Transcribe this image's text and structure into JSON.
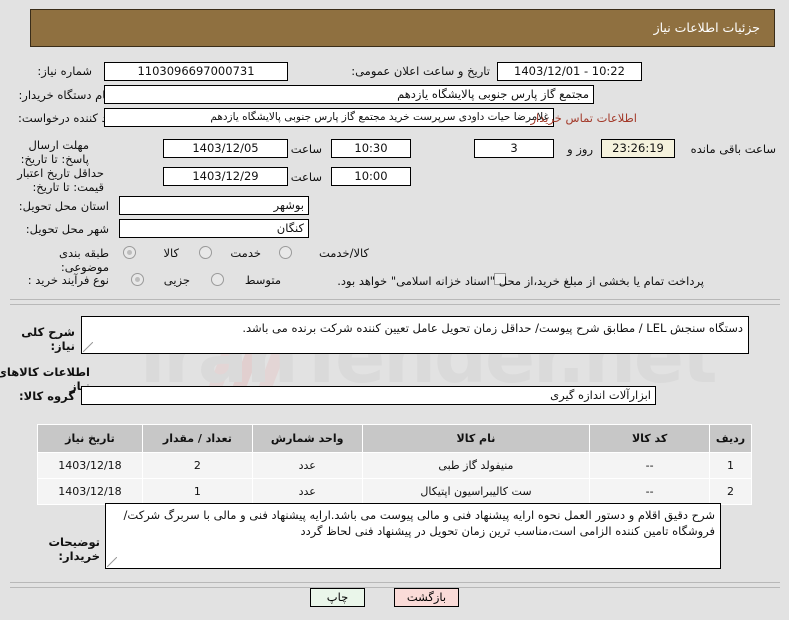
{
  "header": {
    "title": "جزئیات اطلاعات نیاز"
  },
  "watermark": {
    "text": "iranTender.net"
  },
  "form": {
    "need_number": {
      "label": "شماره نیاز:",
      "value": "1103096697000731"
    },
    "public_announce": {
      "label": "تاریخ و ساعت اعلان عمومی:",
      "value": "1403/12/01 - 10:22"
    },
    "buyer_org": {
      "label": "نام دستگاه خریدار:",
      "value": "مجتمع گاز پارس جنوبی  پالایشگاه یازدهم"
    },
    "requester": {
      "label": "ایجاد کننده درخواست:",
      "value": "غلامرضا حیات داودی سرپرست خرید مجتمع گاز پارس جنوبی  پالایشگاه یازدهم"
    },
    "buyer_contact_link": "اطلاعات تماس خریدار",
    "reply_deadline": {
      "label": "مهلت ارسال پاسخ: تا تاریخ:",
      "date": "1403/12/05",
      "time_label": "ساعت",
      "time": "10:30",
      "days": "3",
      "days_suffix": "روز و",
      "countdown": "23:26:19",
      "countdown_suffix": "ساعت باقی مانده"
    },
    "price_validity": {
      "label": "حداقل تاریخ اعتبار قیمت: تا تاریخ:",
      "date": "1403/12/29",
      "time_label": "ساعت",
      "time": "10:00"
    },
    "province": {
      "label": "استان محل تحویل:",
      "value": "بوشهر"
    },
    "city": {
      "label": "شهر محل تحویل:",
      "value": "کنگان"
    },
    "subject_class": {
      "label": "طبقه بندی موضوعی:",
      "options": [
        "کالا",
        "خدمت",
        "کالا/خدمت"
      ],
      "selected": "کالا"
    },
    "purchase_type": {
      "label": "نوع فرآیند خرید :",
      "options": [
        "جزیی",
        "متوسط"
      ],
      "selected": "جزیی"
    },
    "treasury_note": {
      "text": "پرداخت تمام یا بخشی از مبلغ خرید،از محل \"اسناد خزانه اسلامی\" خواهد بود.",
      "checked": false
    },
    "general_desc": {
      "label": "شرح کلی نیاز:",
      "value": "دستگاه سنجش LEL / مطابق شرح پیوست/ حداقل زمان تحویل عامل تعیین کننده شرکت برنده  می باشد."
    },
    "goods_section_title": "اطلاعات کالاهای مورد نیاز",
    "goods_group": {
      "label": "گروه کالا:",
      "value": "ابزارآلات اندازه گیری"
    },
    "buyer_notes": {
      "label": "توضیحات خریدار:",
      "value": "شرح دقیق اقلام و دستور العمل نحوه ارایه پیشنهاد فنی و مالی پیوست می باشد.ارایه پیشنهاد فنی و مالی با سربرگ شرکت/فروشگاه تامین کننده الزامی است،مناسب ترین زمان تحویل در پیشنهاد فنی لحاظ گردد"
    }
  },
  "goods_table": {
    "columns": [
      "ردیف",
      "کد کالا",
      "نام کالا",
      "واحد شمارش",
      "تعداد / مقدار",
      "تاریخ نیاز"
    ],
    "rows": [
      {
        "row": "1",
        "code": "--",
        "name": "منیفولد گاز طبی",
        "unit": "عدد",
        "qty": "2",
        "date": "1403/12/18"
      },
      {
        "row": "2",
        "code": "--",
        "name": "ست کالیبراسیون اپتیکال",
        "unit": "عدد",
        "qty": "1",
        "date": "1403/12/18"
      }
    ]
  },
  "footer": {
    "print_label": "چاپ",
    "back_label": "بازگشت"
  },
  "colors": {
    "header_bg": "#8f7040",
    "link": "#a33a2a",
    "page_bg": "#e2e2e2",
    "table_header_bg": "#c7c7c7",
    "print_btn_bg": "#eaf6ea",
    "back_btn_bg": "#fadbd8",
    "countdown_bg": "#f5f2dd"
  }
}
